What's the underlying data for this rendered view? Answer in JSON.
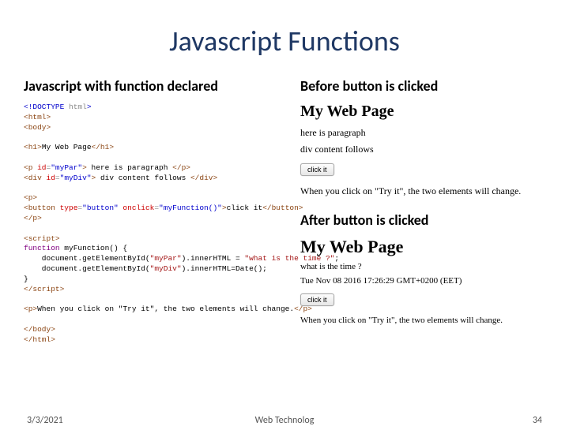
{
  "title": "Javascript Functions",
  "left": {
    "heading": "Javascript with function declared",
    "code": {
      "l1a": "<!DOCTYPE ",
      "l1b": "html",
      "l1c": ">",
      "l2a": "<html>",
      "l3a": "<body>",
      "l5a": "<h1>",
      "l5b": "My Web Page",
      "l5c": "</h1>",
      "l7a": "<p ",
      "l7b": "id",
      "l7c": "=",
      "l7d": "\"myPar\"",
      "l7e": "> ",
      "l7f": "here is paragraph ",
      "l7g": "</p>",
      "l8a": "<div ",
      "l8b": "id",
      "l8c": "=",
      "l8d": "\"myDiv\"",
      "l8e": "> ",
      "l8f": "div content follows ",
      "l8g": "</div>",
      "l10a": "<p>",
      "l11a": "<button ",
      "l11b": "type",
      "l11c": "=",
      "l11d": "\"button\"",
      "l11e": " onclick",
      "l11f": "=",
      "l11g": "\"myFunction()\"",
      "l11h": ">",
      "l11i": "click it",
      "l11j": "</button>",
      "l12a": "</p>",
      "l14a": "<script>",
      "l15a": "function",
      "l15b": " myFunction() {",
      "l16a": "    document.getElementById(",
      "l16b": "\"myPar\"",
      "l16c": ").innerHTML = ",
      "l16d": "\"what is the time ?\"",
      "l16e": ";",
      "l17a": "    document.getElementById(",
      "l17b": "\"myDiv\"",
      "l17c": ").innerHTML=Date();",
      "l18a": "}",
      "l19a": "</script>",
      "l21a": "<p>",
      "l21b": "When you click on \"Try it\", the two elements will change.",
      "l21c": "</p>",
      "l23a": "</body>",
      "l24a": "</html>"
    }
  },
  "right": {
    "before": {
      "heading": "Before button is clicked",
      "h1": "My Web Page",
      "p1": "here is paragraph",
      "p2": "div content follows",
      "button": "click it",
      "p3": "When you click on \"Try it\", the two elements will change."
    },
    "after": {
      "heading": "After button is clicked",
      "h1": "My Web Page",
      "p1": "what is the time ?",
      "p2": "Tue Nov 08 2016 17:26:29 GMT+0200 (EET)",
      "button": "click it",
      "p3": "When you click on \"Try it\", the two elements will change."
    }
  },
  "footer": {
    "date": "3/3/2021",
    "center": "Web Technolog",
    "page": "34"
  }
}
